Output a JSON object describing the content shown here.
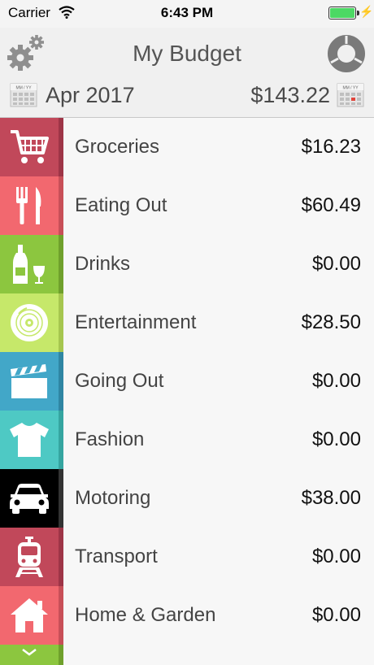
{
  "status_bar": {
    "carrier": "Carrier",
    "time": "6:43 PM",
    "battery_color": "#4cd964"
  },
  "header": {
    "title": "My Budget",
    "month": "Apr 2017",
    "total": "$143.22",
    "calendar_label": "MM / YY",
    "settings_icon": "gear-icon",
    "chart_icon": "donut-chart-icon"
  },
  "categories": [
    {
      "name": "Groceries",
      "amount": "$16.23",
      "icon": "shopping-cart-icon",
      "color": "#c1485a",
      "stripe": "#9e3547"
    },
    {
      "name": "Eating Out",
      "amount": "$60.49",
      "icon": "fork-knife-icon",
      "color": "#f2686f",
      "stripe": "#c84f58"
    },
    {
      "name": "Drinks",
      "amount": "$0.00",
      "icon": "bottle-glass-icon",
      "color": "#8cc63f",
      "stripe": "#6fa02c"
    },
    {
      "name": "Entertainment",
      "amount": "$28.50",
      "icon": "disc-icon",
      "color": "#c6e86a",
      "stripe": "#a6c64f"
    },
    {
      "name": "Going Out",
      "amount": "$0.00",
      "icon": "clapperboard-icon",
      "color": "#42a7c8",
      "stripe": "#2f86a3"
    },
    {
      "name": "Fashion",
      "amount": "$0.00",
      "icon": "tshirt-icon",
      "color": "#4ec9c4",
      "stripe": "#35a5a0"
    },
    {
      "name": "Motoring",
      "amount": "$38.00",
      "icon": "car-icon",
      "color": "#000000",
      "stripe": "#333333"
    },
    {
      "name": "Transport",
      "amount": "$0.00",
      "icon": "train-icon",
      "color": "#c1485a",
      "stripe": "#9e3547"
    },
    {
      "name": "Home & Garden",
      "amount": "$0.00",
      "icon": "house-icon",
      "color": "#f2686f",
      "stripe": "#c84f58"
    }
  ],
  "more": {
    "icon": "chevron-down-icon",
    "color": "#8cc63f",
    "stripe": "#6fa02c"
  }
}
